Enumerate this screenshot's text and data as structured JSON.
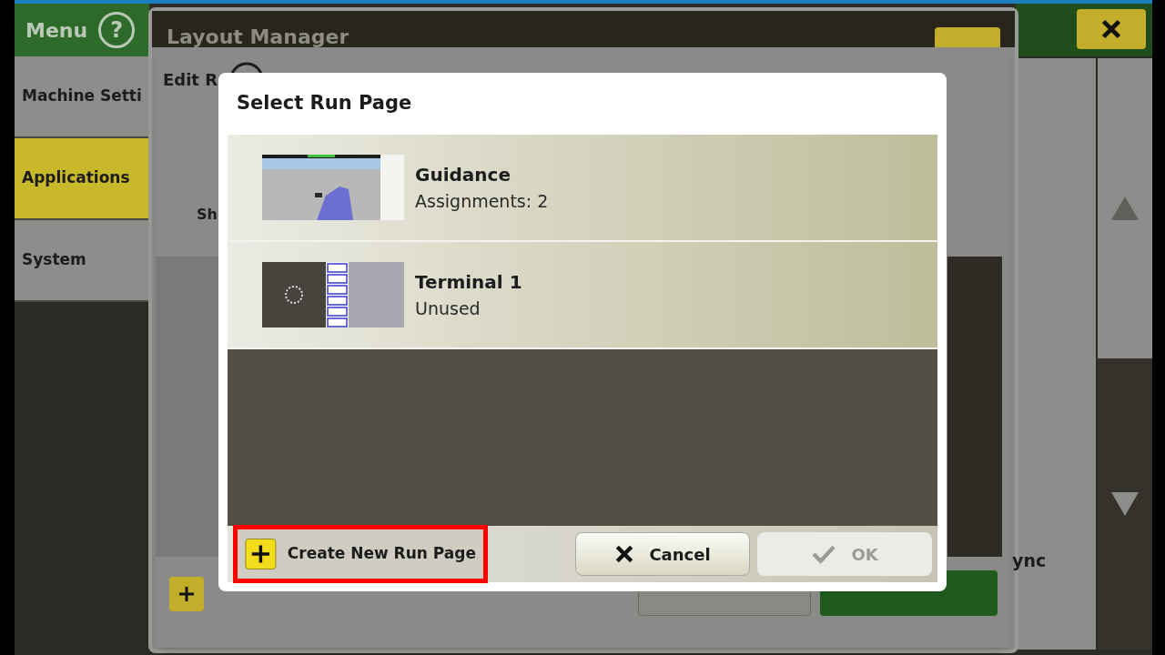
{
  "menu": {
    "title": "Menu",
    "help": "?",
    "items": [
      {
        "label": "Machine Setti",
        "selected": false
      },
      {
        "label": "Applications",
        "selected": true
      },
      {
        "label": "System",
        "selected": false
      }
    ]
  },
  "layout_manager": {
    "title": "Layout Manager"
  },
  "edit_panel": {
    "title": "Edit R",
    "column_1": "Sh",
    "side_label": "ync"
  },
  "dialog": {
    "title": "Select Run Page",
    "pages": [
      {
        "kind": "guidance",
        "name": "Guidance",
        "status": "Assignments: 2"
      },
      {
        "kind": "terminal",
        "name": "Terminal 1",
        "status": "Unused"
      }
    ],
    "create_button": {
      "label": "Create New Run Page",
      "highlighted": true
    },
    "cancel_button": {
      "label": "Cancel"
    },
    "ok_button": {
      "label": "OK",
      "disabled": true
    }
  }
}
